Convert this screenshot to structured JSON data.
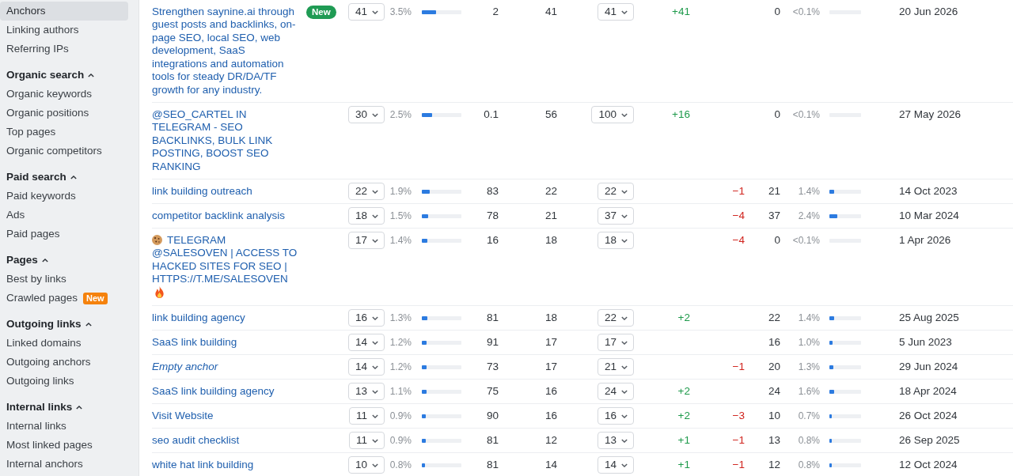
{
  "sidebar": {
    "sections": [
      {
        "items": [
          {
            "label": "Anchors",
            "selected": true
          },
          {
            "label": "Linking authors",
            "selected": false
          },
          {
            "label": "Referring IPs",
            "selected": false
          }
        ]
      },
      {
        "title": "Organic search",
        "expanded": true,
        "items": [
          {
            "label": "Organic keywords",
            "selected": false
          },
          {
            "label": "Organic positions",
            "selected": false
          },
          {
            "label": "Top pages",
            "selected": false
          },
          {
            "label": "Organic competitors",
            "selected": false
          }
        ]
      },
      {
        "title": "Paid search",
        "expanded": true,
        "items": [
          {
            "label": "Paid keywords",
            "selected": false
          },
          {
            "label": "Ads",
            "selected": false
          },
          {
            "label": "Paid pages",
            "selected": false
          }
        ]
      },
      {
        "title": "Pages",
        "expanded": true,
        "items": [
          {
            "label": "Best by links",
            "selected": false
          },
          {
            "label": "Crawled pages",
            "selected": false,
            "badge": "New"
          }
        ]
      },
      {
        "title": "Outgoing links",
        "expanded": true,
        "items": [
          {
            "label": "Linked domains",
            "selected": false
          },
          {
            "label": "Outgoing anchors",
            "selected": false
          },
          {
            "label": "Outgoing links",
            "selected": false
          }
        ]
      },
      {
        "title": "Internal links",
        "expanded": true,
        "items": [
          {
            "label": "Internal links",
            "selected": false
          },
          {
            "label": "Most linked pages",
            "selected": false
          },
          {
            "label": "Internal anchors",
            "selected": false
          }
        ]
      }
    ]
  },
  "table": {
    "rows": [
      {
        "anchor": {
          "text": "Strengthen saynine.ai through guest posts and backlinks, on-page SEO, local SEO, web development, SaaS integrations and automation tools for steady DR/DA/TF growth for any industry.",
          "empty": false
        },
        "badge": "New",
        "column_2": {
          "value": "41",
          "share": "3.5%",
          "level": 0.35
        },
        "column_3": "2",
        "column_4": "41",
        "column_5": "41",
        "column_6": "+41",
        "column_8": {
          "value": "0",
          "share": "<0.1%"
        },
        "column_9": "20 Jun 2026"
      },
      {
        "anchor": {
          "text": "@SEO_CARTEL IN TELEGRAM - SEO BACKLINKS, BULK LINK POSTING, BOOST SEO RANKING",
          "empty": false
        },
        "column_2": {
          "value": "30",
          "share": "2.5%",
          "level": 0.25
        },
        "column_3": "0.1",
        "column_4": "56",
        "column_5": "100",
        "column_6": "+16",
        "column_8": {
          "value": "0",
          "share": "<0.1%"
        },
        "column_9": "27 May 2026"
      },
      {
        "anchor": {
          "text": "link building outreach",
          "empty": false
        },
        "column_2": {
          "value": "22",
          "share": "1.9%",
          "level": 0.19
        },
        "column_3": "83",
        "column_4": "22",
        "column_5": "22",
        "column_7": "−1",
        "column_8": {
          "value": "21",
          "share": "1.4%",
          "level": 0.14
        },
        "column_9": "14 Oct 2023"
      },
      {
        "anchor": {
          "text": "competitor backlink analysis",
          "empty": false
        },
        "column_2": {
          "value": "18",
          "share": "1.5%",
          "level": 0.15
        },
        "column_3": "78",
        "column_4": "21",
        "column_5": "37",
        "column_7": "−4",
        "column_8": {
          "value": "37",
          "share": "2.4%",
          "level": 0.24
        },
        "column_9": "10 Mar 2024"
      },
      {
        "anchor": {
          "text": "TELEGRAM @SALESOVEN | ACCESS TO HACKED SITES FOR SEO | HTTPS://T.ME/SALESOVEN",
          "empty": false,
          "lead_icon": {
            "kind": "cookie"
          },
          "end_icon": {
            "kind": "fire"
          }
        },
        "column_2": {
          "value": "17",
          "share": "1.4%",
          "level": 0.14
        },
        "column_3": "16",
        "column_4": "18",
        "column_5": "18",
        "column_7": "−4",
        "column_8": {
          "value": "0",
          "share": "<0.1%"
        },
        "column_9": "1 Apr 2026"
      },
      {
        "anchor": {
          "text": "link building agency",
          "empty": false
        },
        "column_2": {
          "value": "16",
          "share": "1.3%",
          "level": 0.13
        },
        "column_3": "81",
        "column_4": "18",
        "column_5": "22",
        "column_6": "+2",
        "column_8": {
          "value": "22",
          "share": "1.4%",
          "level": 0.14
        },
        "column_9": "25 Aug 2025"
      },
      {
        "anchor": {
          "text": "SaaS link building",
          "empty": false
        },
        "column_2": {
          "value": "14",
          "share": "1.2%",
          "level": 0.12
        },
        "column_3": "91",
        "column_4": "17",
        "column_5": "17",
        "column_8": {
          "value": "16",
          "share": "1.0%",
          "level": 0.1
        },
        "column_9": "5 Jun 2023"
      },
      {
        "anchor": {
          "text": "Empty anchor",
          "empty": true
        },
        "column_2": {
          "value": "14",
          "share": "1.2%",
          "level": 0.12
        },
        "column_3": "73",
        "column_4": "17",
        "column_5": "21",
        "column_7": "−1",
        "column_8": {
          "value": "20",
          "share": "1.3%",
          "level": 0.13
        },
        "column_9": "29 Jun 2024"
      },
      {
        "anchor": {
          "text": "SaaS link building agency",
          "empty": false
        },
        "column_2": {
          "value": "13",
          "share": "1.1%",
          "level": 0.11
        },
        "column_3": "75",
        "column_4": "16",
        "column_5": "24",
        "column_6": "+2",
        "column_8": {
          "value": "24",
          "share": "1.6%",
          "level": 0.16
        },
        "column_9": "18 Apr 2024"
      },
      {
        "anchor": {
          "text": "Visit Website",
          "empty": false
        },
        "column_2": {
          "value": "11",
          "share": "0.9%",
          "level": 0.09
        },
        "column_3": "90",
        "column_4": "16",
        "column_5": "16",
        "column_6": "+2",
        "column_7": "−3",
        "column_8": {
          "value": "10",
          "share": "0.7%",
          "level": 0.07
        },
        "column_9": "26 Oct 2024"
      },
      {
        "anchor": {
          "text": "seo audit checklist",
          "empty": false
        },
        "column_2": {
          "value": "11",
          "share": "0.9%",
          "level": 0.09
        },
        "column_3": "81",
        "column_4": "12",
        "column_5": "13",
        "column_6": "+1",
        "column_7": "−1",
        "column_8": {
          "value": "13",
          "share": "0.8%",
          "level": 0.08
        },
        "column_9": "26 Sep 2025"
      },
      {
        "anchor": {
          "text": "white hat link building",
          "empty": false
        },
        "column_2": {
          "value": "10",
          "share": "0.8%",
          "level": 0.08
        },
        "column_3": "81",
        "column_4": "14",
        "column_5": "14",
        "column_6": "+1",
        "column_7": "−1",
        "column_8": {
          "value": "12",
          "share": "0.8%",
          "level": 0.08
        },
        "column_9": "12 Oct 2024"
      }
    ]
  }
}
